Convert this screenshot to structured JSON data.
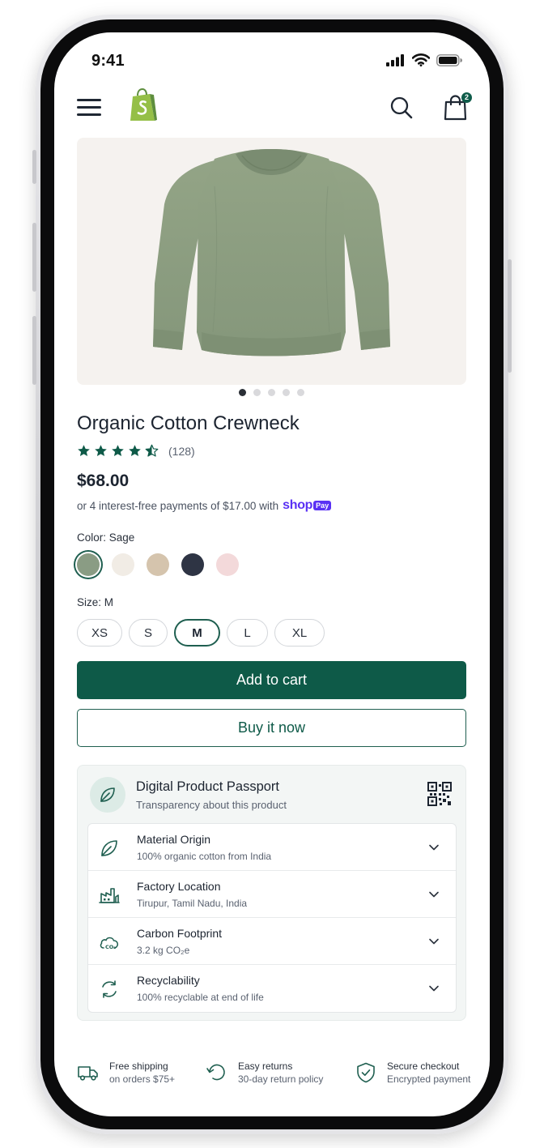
{
  "status_bar": {
    "time": "9:41"
  },
  "header": {
    "cart_count": "2"
  },
  "product": {
    "title": "Organic Cotton Crewneck",
    "rating": 4.5,
    "review_count": "(128)",
    "price": "$68.00",
    "installments_text": "or 4 interest-free payments of $17.00 with",
    "shop_pay_word": "shop",
    "shop_pay_badge": "Pay",
    "image_count": 5,
    "active_image": 1,
    "image_alt": "Sage green crewneck sweatshirt"
  },
  "color": {
    "label": "Color:",
    "selected": "Sage",
    "swatches": [
      {
        "name": "Sage",
        "hex": "#8a9c84"
      },
      {
        "name": "Cream",
        "hex": "#f1ece5"
      },
      {
        "name": "Oat",
        "hex": "#d5c4ad"
      },
      {
        "name": "Navy",
        "hex": "#2e3444"
      },
      {
        "name": "Blush",
        "hex": "#f3d9da"
      }
    ]
  },
  "size": {
    "label": "Size:",
    "selected": "M",
    "options": [
      "XS",
      "S",
      "M",
      "L",
      "XL"
    ]
  },
  "actions": {
    "add_to_cart": "Add to cart",
    "buy_now": "Buy it now"
  },
  "passport": {
    "title": "Digital Product Passport",
    "subtitle": "Transparency about this product",
    "items": [
      {
        "icon": "leaf-icon",
        "title": "Material Origin",
        "value": "100% organic cotton from India"
      },
      {
        "icon": "factory-icon",
        "title": "Factory Location",
        "value": "Tirupur, Tamil Nadu, India"
      },
      {
        "icon": "cloud-co2-icon",
        "title": "Carbon Footprint",
        "value": "3.2 kg CO₂e"
      },
      {
        "icon": "recycle-icon",
        "title": "Recyclability",
        "value": "100% recyclable at end of life"
      }
    ]
  },
  "trust": [
    {
      "icon": "truck-icon",
      "title": "Free shipping",
      "subtitle": "on orders $75+"
    },
    {
      "icon": "return-arrow-icon",
      "title": "Easy returns",
      "subtitle": "30-day return policy"
    },
    {
      "icon": "shield-check-icon",
      "title": "Secure checkout",
      "subtitle": "Encrypted payment"
    }
  ],
  "colors": {
    "accent": "#0e5a48",
    "shop_pay": "#5a31f4",
    "logo_green": "#95bf47"
  }
}
